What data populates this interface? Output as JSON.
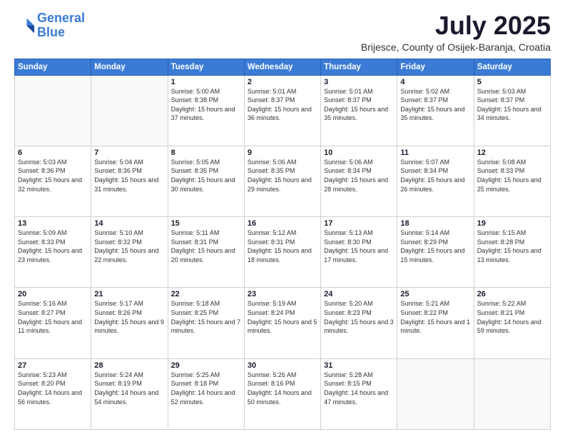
{
  "header": {
    "logo_line1": "General",
    "logo_line2": "Blue",
    "month_year": "July 2025",
    "location": "Brijesce, County of Osijek-Baranja, Croatia"
  },
  "days_of_week": [
    "Sunday",
    "Monday",
    "Tuesday",
    "Wednesday",
    "Thursday",
    "Friday",
    "Saturday"
  ],
  "weeks": [
    [
      {
        "day": "",
        "sunrise": "",
        "sunset": "",
        "daylight": ""
      },
      {
        "day": "",
        "sunrise": "",
        "sunset": "",
        "daylight": ""
      },
      {
        "day": "1",
        "sunrise": "Sunrise: 5:00 AM",
        "sunset": "Sunset: 8:38 PM",
        "daylight": "Daylight: 15 hours and 37 minutes."
      },
      {
        "day": "2",
        "sunrise": "Sunrise: 5:01 AM",
        "sunset": "Sunset: 8:37 PM",
        "daylight": "Daylight: 15 hours and 36 minutes."
      },
      {
        "day": "3",
        "sunrise": "Sunrise: 5:01 AM",
        "sunset": "Sunset: 8:37 PM",
        "daylight": "Daylight: 15 hours and 35 minutes."
      },
      {
        "day": "4",
        "sunrise": "Sunrise: 5:02 AM",
        "sunset": "Sunset: 8:37 PM",
        "daylight": "Daylight: 15 hours and 35 minutes."
      },
      {
        "day": "5",
        "sunrise": "Sunrise: 5:03 AM",
        "sunset": "Sunset: 8:37 PM",
        "daylight": "Daylight: 15 hours and 34 minutes."
      }
    ],
    [
      {
        "day": "6",
        "sunrise": "Sunrise: 5:03 AM",
        "sunset": "Sunset: 8:36 PM",
        "daylight": "Daylight: 15 hours and 32 minutes."
      },
      {
        "day": "7",
        "sunrise": "Sunrise: 5:04 AM",
        "sunset": "Sunset: 8:36 PM",
        "daylight": "Daylight: 15 hours and 31 minutes."
      },
      {
        "day": "8",
        "sunrise": "Sunrise: 5:05 AM",
        "sunset": "Sunset: 8:35 PM",
        "daylight": "Daylight: 15 hours and 30 minutes."
      },
      {
        "day": "9",
        "sunrise": "Sunrise: 5:06 AM",
        "sunset": "Sunset: 8:35 PM",
        "daylight": "Daylight: 15 hours and 29 minutes."
      },
      {
        "day": "10",
        "sunrise": "Sunrise: 5:06 AM",
        "sunset": "Sunset: 8:34 PM",
        "daylight": "Daylight: 15 hours and 28 minutes."
      },
      {
        "day": "11",
        "sunrise": "Sunrise: 5:07 AM",
        "sunset": "Sunset: 8:34 PM",
        "daylight": "Daylight: 15 hours and 26 minutes."
      },
      {
        "day": "12",
        "sunrise": "Sunrise: 5:08 AM",
        "sunset": "Sunset: 8:33 PM",
        "daylight": "Daylight: 15 hours and 25 minutes."
      }
    ],
    [
      {
        "day": "13",
        "sunrise": "Sunrise: 5:09 AM",
        "sunset": "Sunset: 8:33 PM",
        "daylight": "Daylight: 15 hours and 23 minutes."
      },
      {
        "day": "14",
        "sunrise": "Sunrise: 5:10 AM",
        "sunset": "Sunset: 8:32 PM",
        "daylight": "Daylight: 15 hours and 22 minutes."
      },
      {
        "day": "15",
        "sunrise": "Sunrise: 5:11 AM",
        "sunset": "Sunset: 8:31 PM",
        "daylight": "Daylight: 15 hours and 20 minutes."
      },
      {
        "day": "16",
        "sunrise": "Sunrise: 5:12 AM",
        "sunset": "Sunset: 8:31 PM",
        "daylight": "Daylight: 15 hours and 18 minutes."
      },
      {
        "day": "17",
        "sunrise": "Sunrise: 5:13 AM",
        "sunset": "Sunset: 8:30 PM",
        "daylight": "Daylight: 15 hours and 17 minutes."
      },
      {
        "day": "18",
        "sunrise": "Sunrise: 5:14 AM",
        "sunset": "Sunset: 8:29 PM",
        "daylight": "Daylight: 15 hours and 15 minutes."
      },
      {
        "day": "19",
        "sunrise": "Sunrise: 5:15 AM",
        "sunset": "Sunset: 8:28 PM",
        "daylight": "Daylight: 15 hours and 13 minutes."
      }
    ],
    [
      {
        "day": "20",
        "sunrise": "Sunrise: 5:16 AM",
        "sunset": "Sunset: 8:27 PM",
        "daylight": "Daylight: 15 hours and 11 minutes."
      },
      {
        "day": "21",
        "sunrise": "Sunrise: 5:17 AM",
        "sunset": "Sunset: 8:26 PM",
        "daylight": "Daylight: 15 hours and 9 minutes."
      },
      {
        "day": "22",
        "sunrise": "Sunrise: 5:18 AM",
        "sunset": "Sunset: 8:25 PM",
        "daylight": "Daylight: 15 hours and 7 minutes."
      },
      {
        "day": "23",
        "sunrise": "Sunrise: 5:19 AM",
        "sunset": "Sunset: 8:24 PM",
        "daylight": "Daylight: 15 hours and 5 minutes."
      },
      {
        "day": "24",
        "sunrise": "Sunrise: 5:20 AM",
        "sunset": "Sunset: 8:23 PM",
        "daylight": "Daylight: 15 hours and 3 minutes."
      },
      {
        "day": "25",
        "sunrise": "Sunrise: 5:21 AM",
        "sunset": "Sunset: 8:22 PM",
        "daylight": "Daylight: 15 hours and 1 minute."
      },
      {
        "day": "26",
        "sunrise": "Sunrise: 5:22 AM",
        "sunset": "Sunset: 8:21 PM",
        "daylight": "Daylight: 14 hours and 59 minutes."
      }
    ],
    [
      {
        "day": "27",
        "sunrise": "Sunrise: 5:23 AM",
        "sunset": "Sunset: 8:20 PM",
        "daylight": "Daylight: 14 hours and 56 minutes."
      },
      {
        "day": "28",
        "sunrise": "Sunrise: 5:24 AM",
        "sunset": "Sunset: 8:19 PM",
        "daylight": "Daylight: 14 hours and 54 minutes."
      },
      {
        "day": "29",
        "sunrise": "Sunrise: 5:25 AM",
        "sunset": "Sunset: 8:18 PM",
        "daylight": "Daylight: 14 hours and 52 minutes."
      },
      {
        "day": "30",
        "sunrise": "Sunrise: 5:26 AM",
        "sunset": "Sunset: 8:16 PM",
        "daylight": "Daylight: 14 hours and 50 minutes."
      },
      {
        "day": "31",
        "sunrise": "Sunrise: 5:28 AM",
        "sunset": "Sunset: 8:15 PM",
        "daylight": "Daylight: 14 hours and 47 minutes."
      },
      {
        "day": "",
        "sunrise": "",
        "sunset": "",
        "daylight": ""
      },
      {
        "day": "",
        "sunrise": "",
        "sunset": "",
        "daylight": ""
      }
    ]
  ]
}
